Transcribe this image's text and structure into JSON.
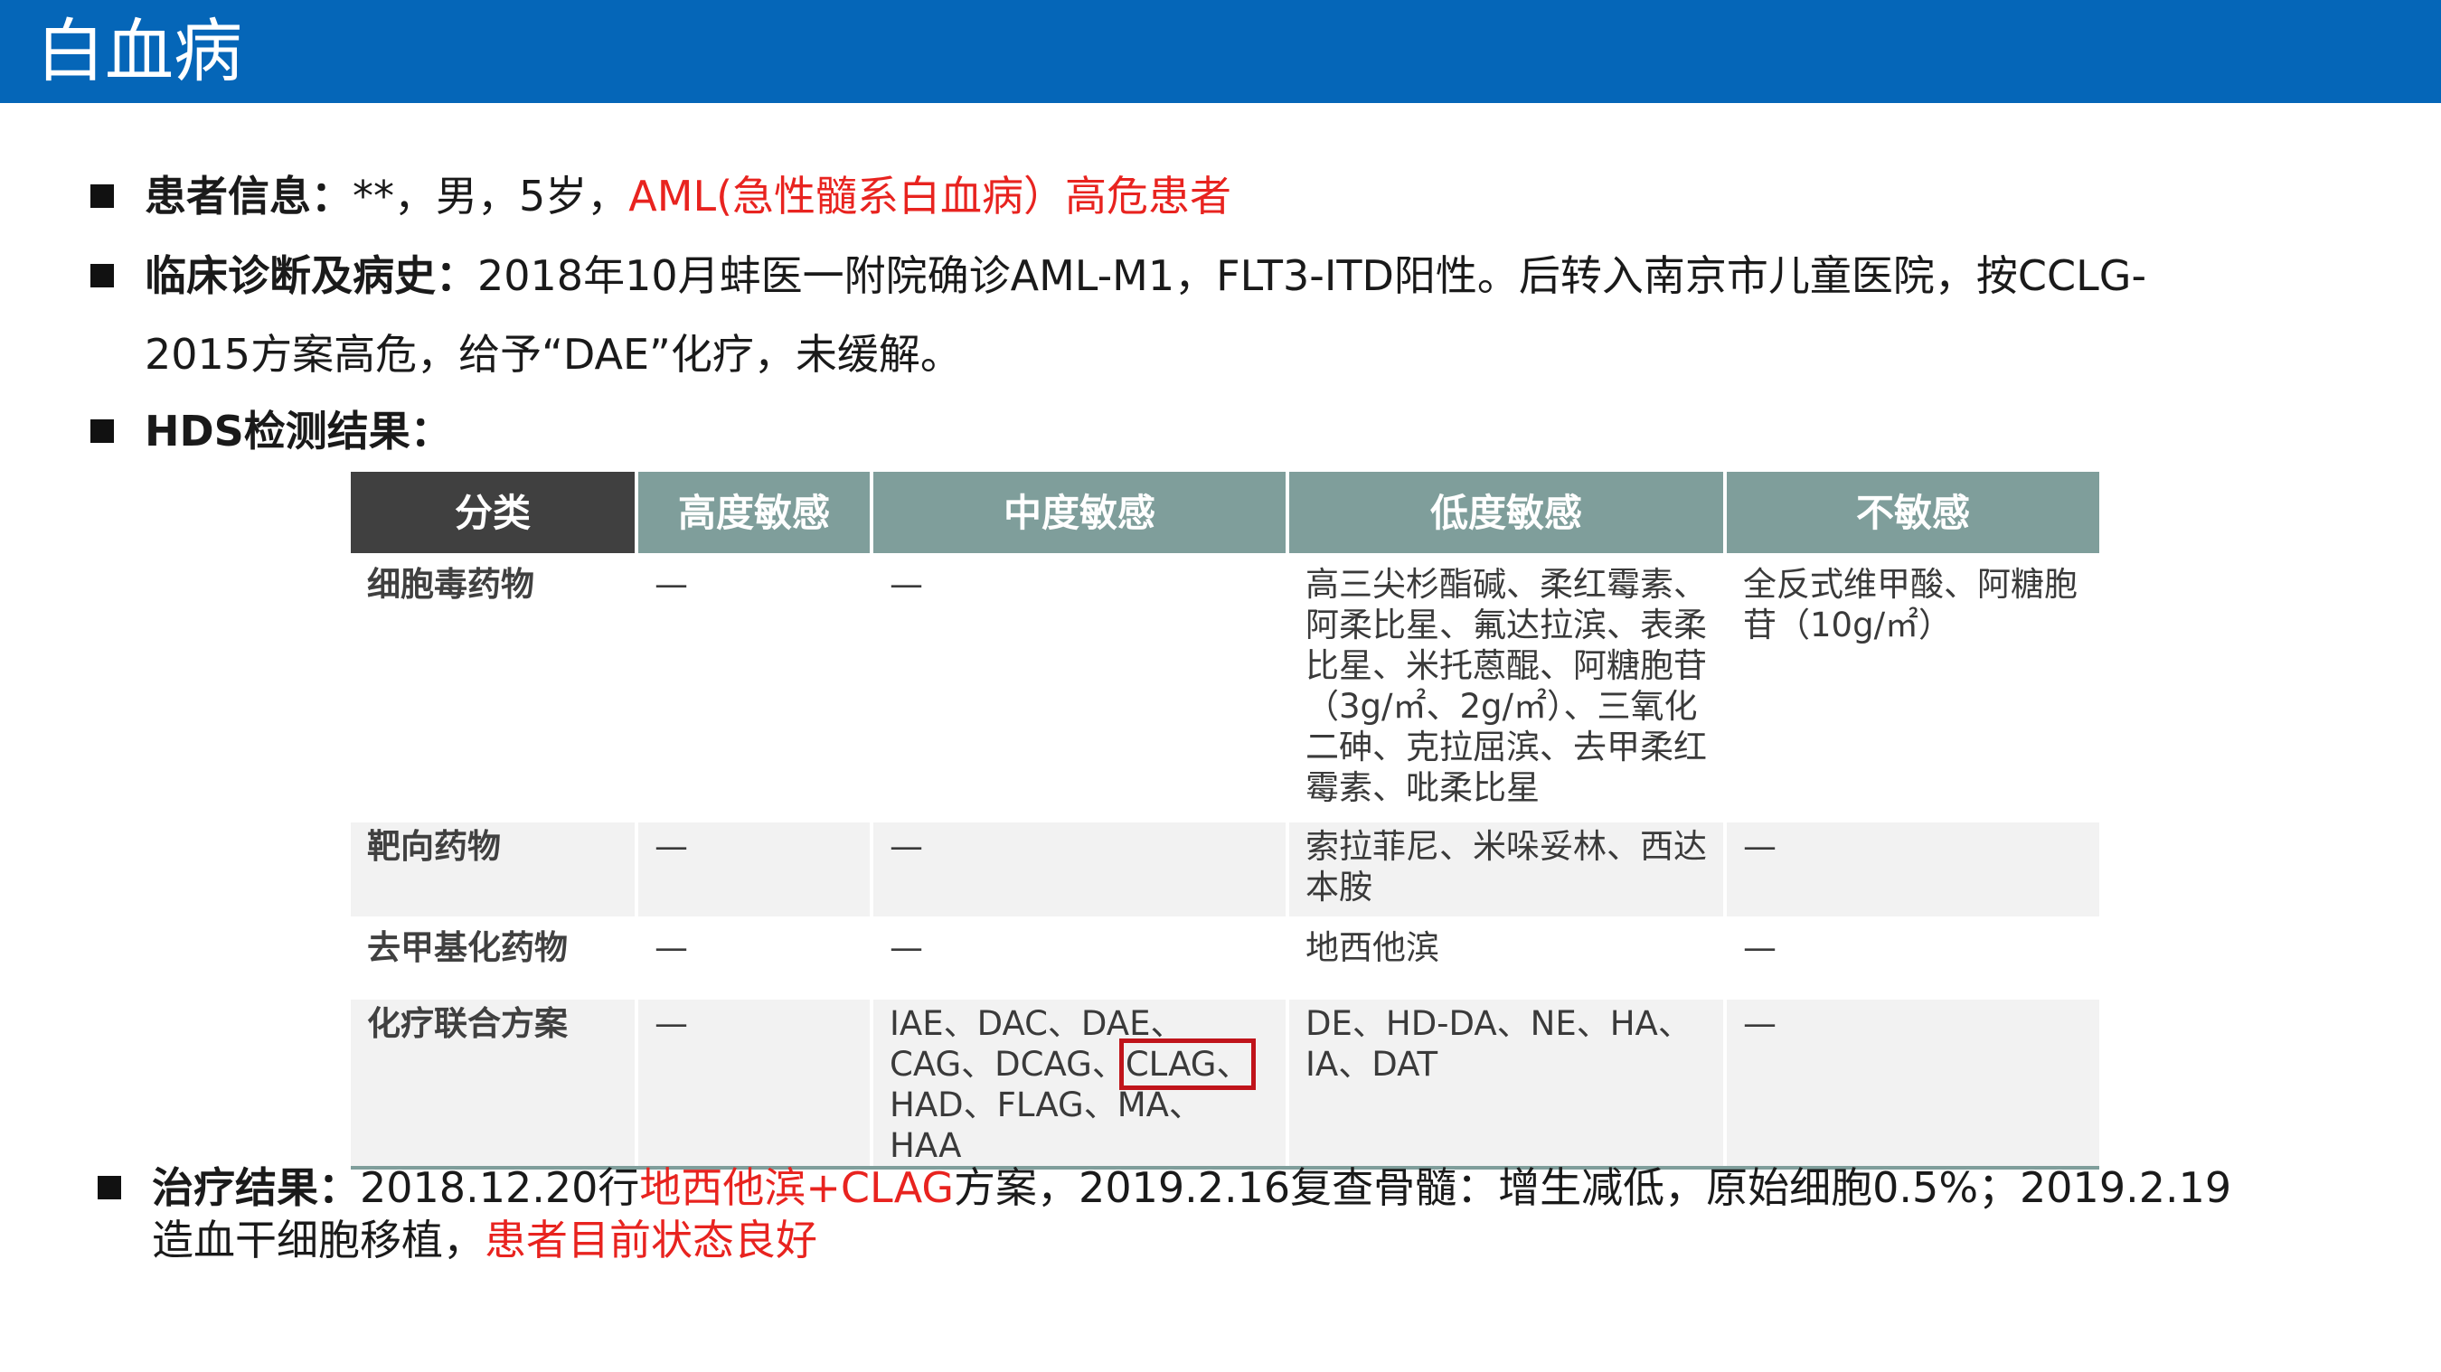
{
  "header": {
    "title": "白血病"
  },
  "patient": {
    "label": "患者信息：",
    "plain": "**，男，5岁，",
    "highlight": "AML(急性髓系白血病）高危患者"
  },
  "diagnosis": {
    "label": "临床诊断及病史：",
    "line1": "2018年10月蚌医一附院确诊AML-M1，FLT3-ITD阳性。后转入南京市儿童医院，按CCLG-",
    "line2": "2015方案高危，给予“DAE”化疗，未缓解。"
  },
  "hds": {
    "label": "HDS检测结果："
  },
  "table": {
    "headers": [
      "分类",
      "高度敏感",
      "中度敏感",
      "低度敏感",
      "不敏感"
    ],
    "rows": [
      {
        "category": "细胞毒药物",
        "high": "—",
        "mid": "—",
        "low": "高三尖杉酯碱、柔红霉素、阿柔比星、氟达拉滨、表柔比星、米托蒽醌、阿糖胞苷（3g/㎡、2g/㎡）、三氧化二砷、克拉屈滨、去甲柔红霉素、吡柔比星",
        "none": "全反式维甲酸、阿糖胞苷（10g/㎡）"
      },
      {
        "category": "靶向药物",
        "high": "—",
        "mid": "—",
        "low": "索拉菲尼、米哚妥林、西达本胺",
        "none": "—"
      },
      {
        "category": "去甲基化药物",
        "high": "—",
        "mid": "—",
        "low": "地西他滨",
        "none": "—"
      },
      {
        "category": "化疗联合方案",
        "high": "—",
        "mid_before": "IAE、DAC、DAE、CAG、DCAG、",
        "mid_highlight": "CLAG、",
        "mid_after": "HAD、FLAG、MA、HAA",
        "low": "DE、HD-DA、NE、HA、IA、DAT",
        "none": "—"
      }
    ]
  },
  "result": {
    "label": "治疗结果：",
    "part1": "2018.12.20行",
    "highlight1": "地西他滨+CLAG",
    "part2": "方案，2019.2.16复查骨髓：增生减低，原始细胞0.5%；2019.2.19",
    "line2_plain": "造血干细胞移植，",
    "highlight2": "患者目前状态良好"
  },
  "colors": {
    "header_blue": "#0566b8",
    "highlight_red": "#e8231f",
    "table_header_teal": "#7f9e9b",
    "table_header_dark": "#404040"
  }
}
